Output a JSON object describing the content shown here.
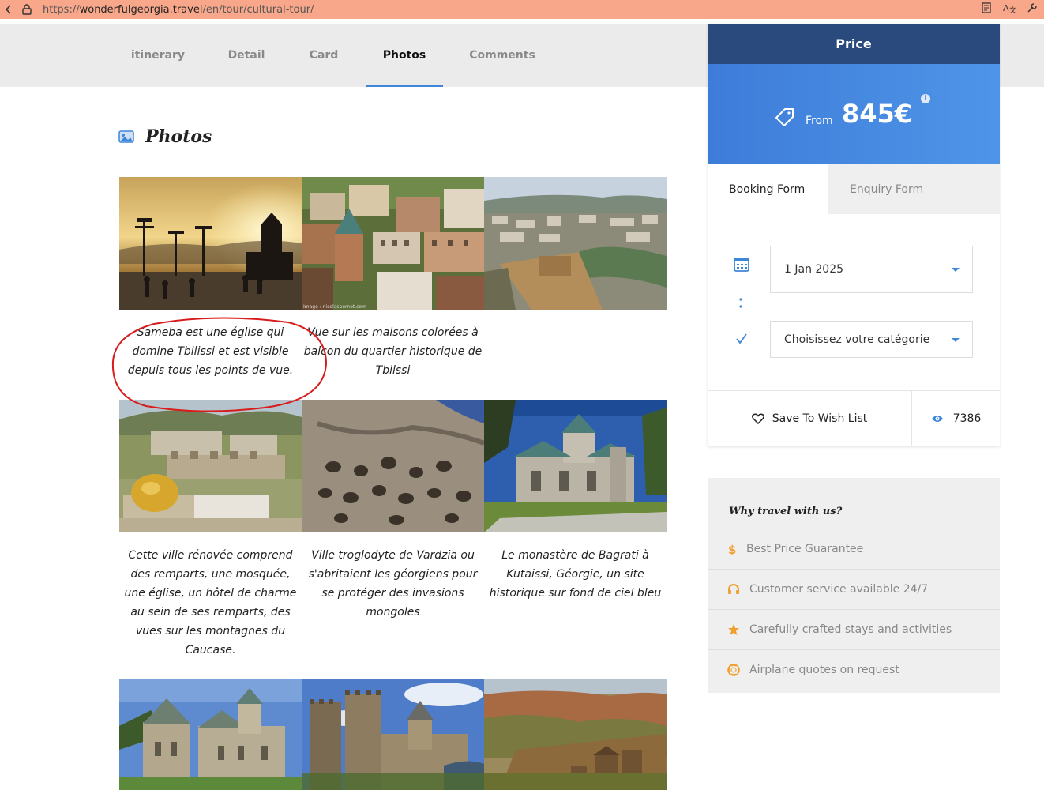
{
  "browser": {
    "url_scheme": "https://",
    "url_host": "wonderfulgeorgia.travel",
    "url_path": "/en/tour/cultural-tour/"
  },
  "tabs": [
    {
      "label": "itinerary"
    },
    {
      "label": "Detail"
    },
    {
      "label": "Card"
    },
    {
      "label": "Photos",
      "active": true
    },
    {
      "label": "Comments"
    }
  ],
  "photos": {
    "title": "Photos",
    "captions": [
      "Sameba est une église qui domine Tbilissi et est visible depuis tous les points de vue.",
      "Vue sur les maisons colorées à balcon du quartier historique de Tbilssi",
      "",
      "Cette ville rénovée comprend des remparts, une mosquée, une église, un hôtel de charme au sein de ses remparts, des vues sur les montagnes du Caucase.",
      "Ville troglodyte de Vardzia ou s'abritaient les géorgiens pour se protéger des invasions mongoles",
      "Le monastère de Bagrati à Kutaissi, Géorgie, un site historique sur fond de ciel bleu"
    ],
    "watermark": "Image : nicolaspernot.com"
  },
  "sidebar": {
    "price_title": "Price",
    "from_label": "From",
    "price": "845€",
    "form_tabs": [
      "Booking Form",
      "Enquiry Form"
    ],
    "date_value": "1 Jan 2025",
    "category_placeholder": "Choisissez votre catégorie",
    "wish_label": "Save To Wish List",
    "views_count": "7386"
  },
  "why": {
    "title": "Why travel with us?",
    "items": [
      {
        "icon": "dollar-icon",
        "label": "Best Price Guarantee"
      },
      {
        "icon": "headset-icon",
        "label": "Customer service available 24/7"
      },
      {
        "icon": "star-icon",
        "label": "Carefully crafted stays and activities"
      },
      {
        "icon": "lifebuoy-icon",
        "label": "Airplane quotes on request"
      }
    ]
  },
  "colors": {
    "accent_blue": "#3e86d8",
    "navy": "#2a4a7e",
    "orange": "#f0a030",
    "annotation_red": "#d81c1c",
    "urlbar": "#f9a78a"
  }
}
